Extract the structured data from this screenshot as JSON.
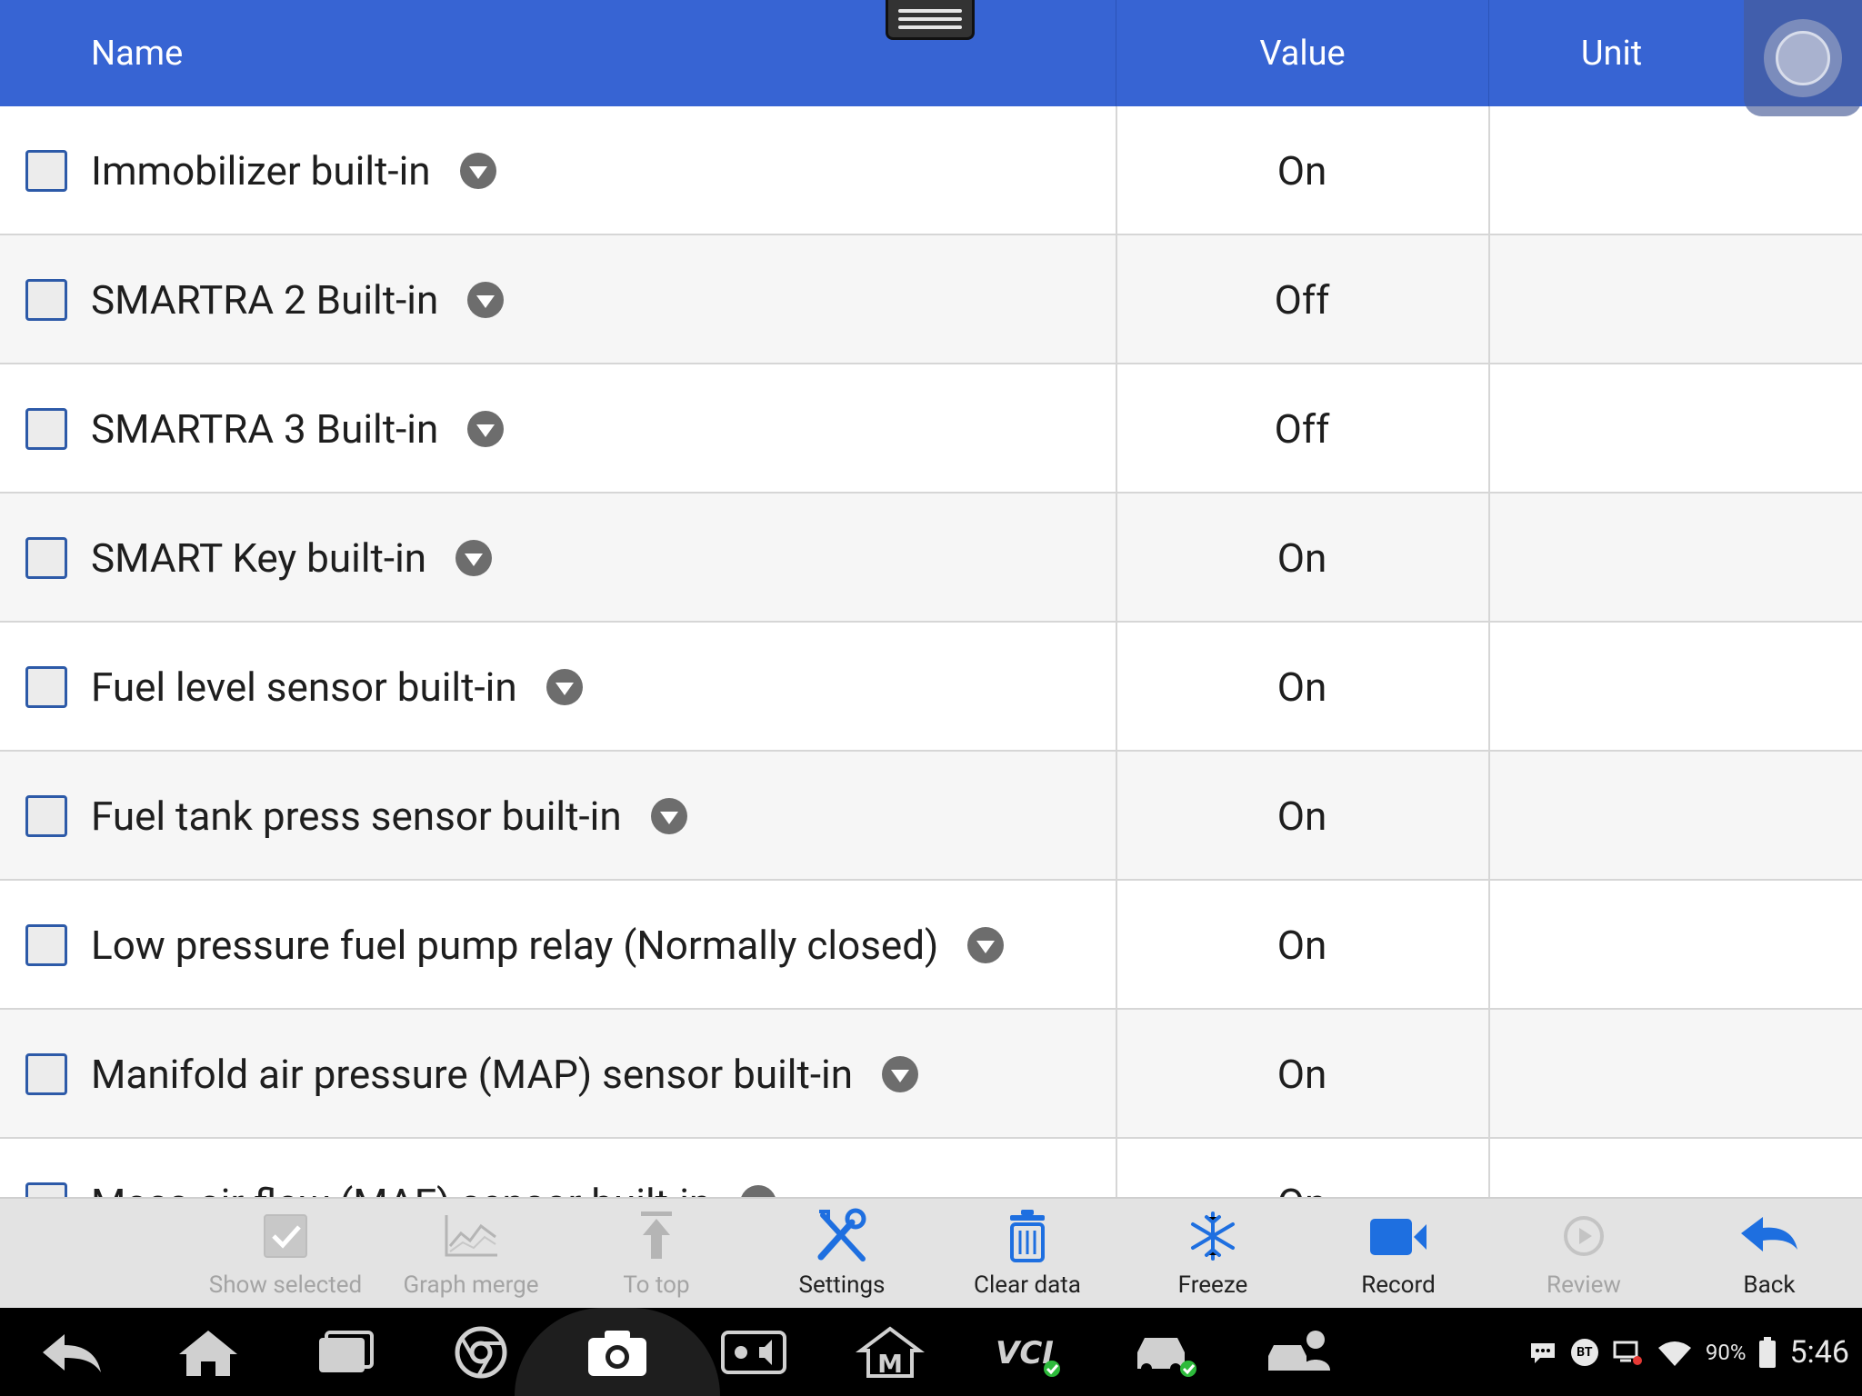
{
  "header": {
    "name": "Name",
    "value": "Value",
    "unit": "Unit"
  },
  "rows": [
    {
      "name": "Immobilizer built-in",
      "value": "On",
      "unit": ""
    },
    {
      "name": "SMARTRA 2 Built-in",
      "value": "Off",
      "unit": ""
    },
    {
      "name": "SMARTRA 3 Built-in",
      "value": "Off",
      "unit": ""
    },
    {
      "name": "SMART Key built-in",
      "value": "On",
      "unit": ""
    },
    {
      "name": "Fuel level sensor built-in",
      "value": "On",
      "unit": ""
    },
    {
      "name": "Fuel tank press sensor built-in",
      "value": "On",
      "unit": ""
    },
    {
      "name": "Low pressure fuel pump relay (Normally closed)",
      "value": "On",
      "unit": ""
    },
    {
      "name": "Manifold air pressure (MAP) sensor built-in",
      "value": "On",
      "unit": ""
    },
    {
      "name": "Mass air flow (MAF) sensor built-in",
      "value": "On",
      "unit": ""
    }
  ],
  "toolbar": {
    "show_selected": "Show selected",
    "graph_merge": "Graph merge",
    "to_top": "To top",
    "settings": "Settings",
    "clear_data": "Clear data",
    "freeze": "Freeze",
    "record": "Record",
    "review": "Review",
    "back": "Back"
  },
  "status": {
    "battery": "90%",
    "time": "5:46",
    "bt": "BT",
    "vci": "VCI"
  },
  "colors": {
    "header": "#3764d3",
    "accent": "#1e6fe0",
    "toolbar": "#e3e3e3"
  }
}
